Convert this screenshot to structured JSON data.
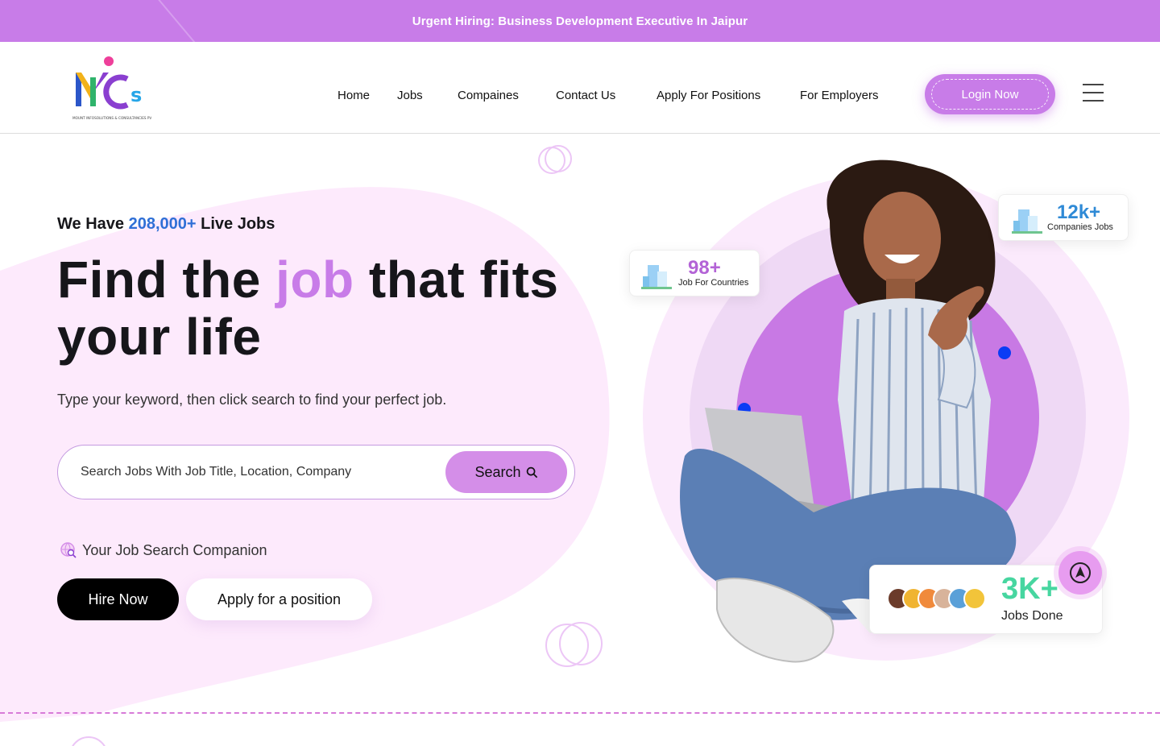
{
  "announcement": "Urgent Hiring: Business Development Executive In Jaipur",
  "brand": {
    "logo_letters": "MICS",
    "logo_tagline": "MOUNT INFOSOLUTIONS & CONSULTANCIES PVT.LTD",
    "accent": "#c87ce8",
    "highlight_blue": "#2f6fd6"
  },
  "nav": {
    "items": [
      "Home",
      "Jobs",
      "Compaines",
      "Contact Us",
      "Apply For Positions",
      "For Employers"
    ],
    "login_label": "Login Now",
    "menu_icon": "hamburger-icon"
  },
  "hero": {
    "tag_prefix": "We Have",
    "tag_count": "208,000+",
    "tag_suffix": "Live Jobs",
    "title_part1": "Find the",
    "title_highlight": "job",
    "title_part2": "that fits your life",
    "subtitle": "Type your keyword, then click search to find your perfect job.",
    "search_placeholder": "Search Jobs With Job Title, Location, Company",
    "search_button": "Search",
    "companion_label": "Your Job Search Companion",
    "hire_button": "Hire Now",
    "apply_button": "Apply for a position"
  },
  "stats": {
    "countries": {
      "value": "98+",
      "label": "Job For Countries"
    },
    "companies": {
      "value": "12k+",
      "label": "Companies Jobs"
    },
    "jobs_done": {
      "value": "3K+",
      "label": "Jobs Done"
    }
  }
}
